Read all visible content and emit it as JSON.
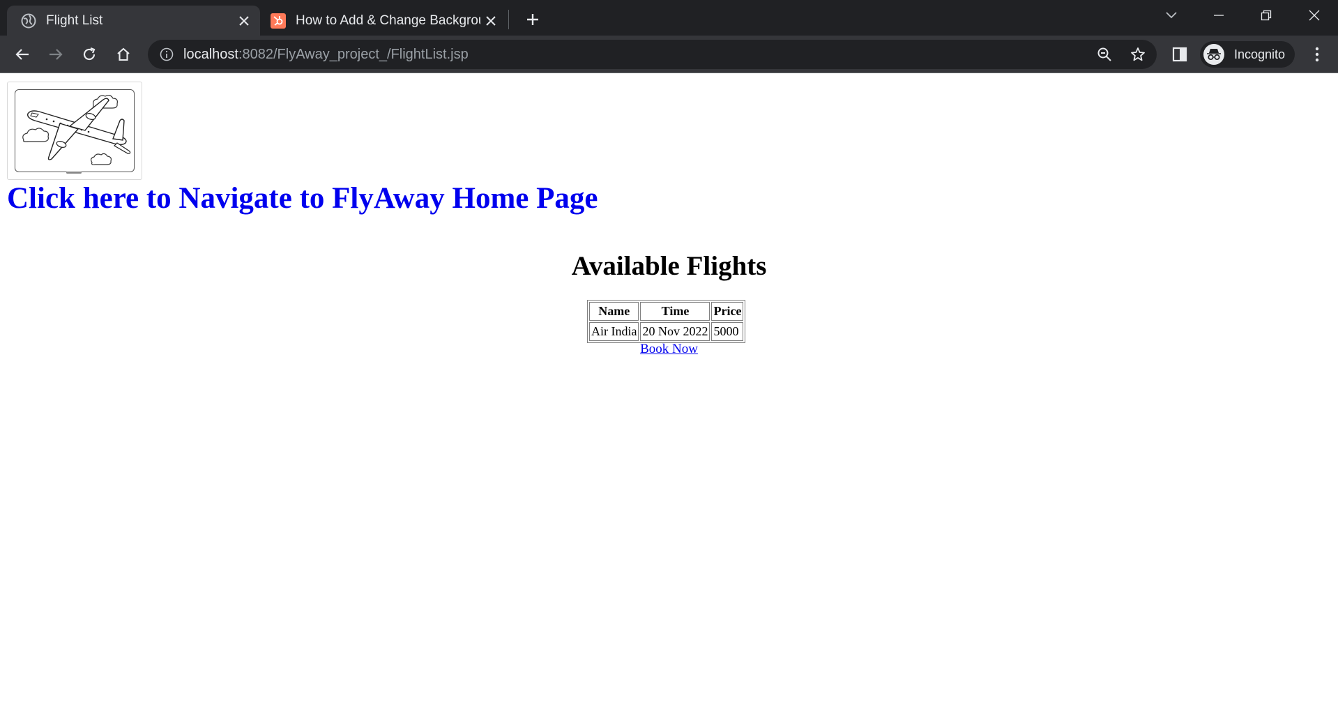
{
  "browser": {
    "tabs": [
      {
        "title": "Flight List",
        "active": true
      },
      {
        "title": "How to Add & Change Background",
        "active": false
      }
    ],
    "address_bar": {
      "host": "localhost",
      "path": ":8082/FlyAway_project_/FlightList.jsp"
    },
    "profile_label": "Incognito"
  },
  "page": {
    "home_link": "Click here to Navigate to FlyAway Home Page",
    "heading": "Available Flights",
    "table": {
      "headers": [
        "Name",
        "Time",
        "Price"
      ],
      "rows": [
        [
          "Air India",
          "20 Nov 2022",
          "5000"
        ]
      ]
    },
    "book_link": "Book Now"
  },
  "colors": {
    "link": "#0000ee",
    "chrome_dark": "#202124",
    "chrome_toolbar": "#35363a"
  }
}
